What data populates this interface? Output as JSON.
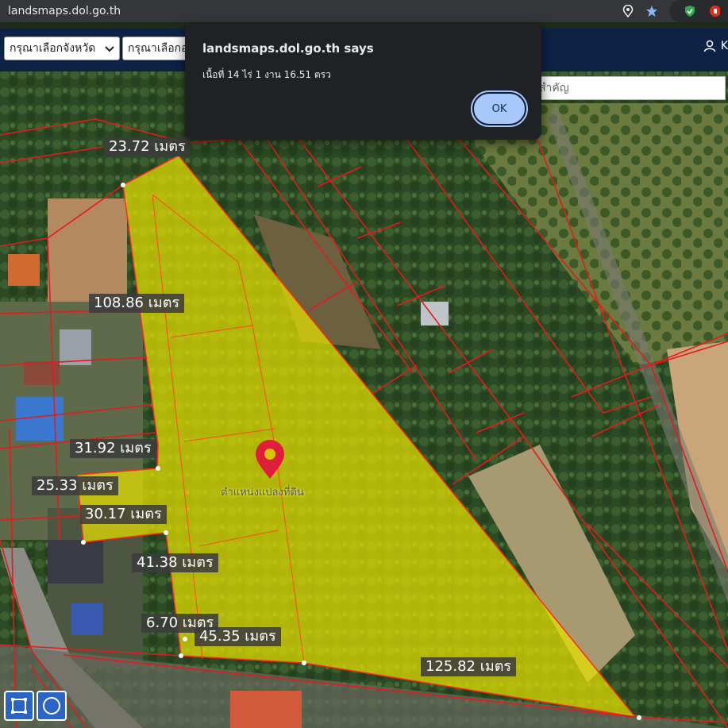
{
  "browser": {
    "url": "landsmaps.dol.go.th",
    "icons": [
      "location-pin-icon",
      "star-icon",
      "shield-extension-icon",
      "extension-icon"
    ]
  },
  "header": {
    "province_select": "กรุณาเลือกจังหวัด",
    "district_select": "กรุณาเลือกอ",
    "user_label": "K"
  },
  "search": {
    "placeholder": "สำคัญ"
  },
  "dialog": {
    "title": "landsmaps.dol.go.th says",
    "message": "เนื้อที่ 14 ไร่ 1 งาน 16.51 ตรว",
    "ok_label": "OK"
  },
  "map": {
    "marker_label": "ตำแหน่งแปลงที่ดิน",
    "highlight_color": "#e6e000",
    "boundary_color": "#e02020",
    "dimensions": [
      "23.72 เมตร",
      "108.86 เมตร",
      "31.92 เมตร",
      "25.33 เมตร",
      "30.17 เมตร",
      "41.38 เมตร",
      "6.70 เมตร",
      "45.35 เมตร",
      "125.82 เมตร"
    ]
  },
  "tools": [
    "rectangle-draw-icon",
    "circle-draw-icon"
  ]
}
